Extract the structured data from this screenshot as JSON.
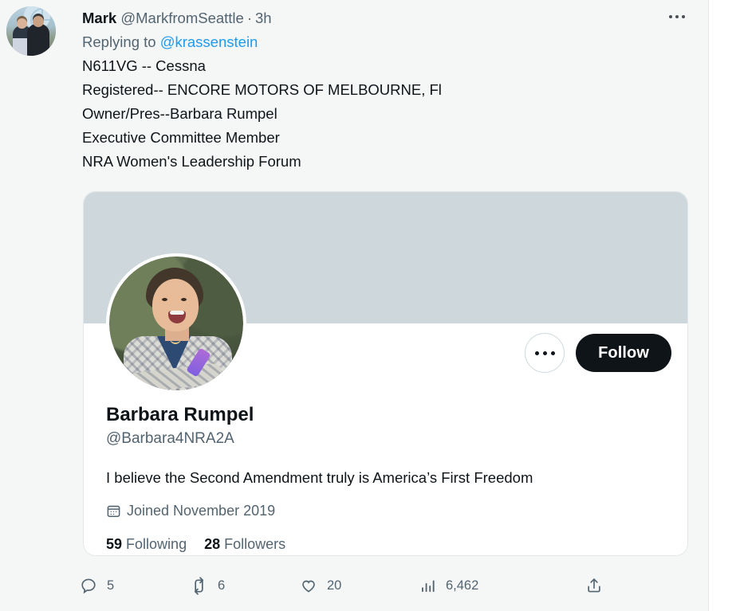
{
  "tweet": {
    "author_name": "Mark",
    "author_handle": "@MarkfromSeattle",
    "separator": "·",
    "timestamp": "3h",
    "replying_prefix": "Replying to",
    "replying_to_handle": "@krassenstein",
    "body": "N611VG -- Cessna\nRegistered-- ENCORE MOTORS OF MELBOURNE, Fl\nOwner/Pres--Barbara Rumpel\nExecutive Committee Member\nNRA Women's Leadership Forum",
    "more_icon": "more-horizontal-icon"
  },
  "profile_card": {
    "banner_color": "#ced8dc",
    "display_name": "Barbara Rumpel",
    "handle": "@Barbara4NRA2A",
    "bio": "I believe the Second Amendment truly is America’s First Freedom",
    "joined_icon": "calendar-icon",
    "joined": "Joined November 2019",
    "following_count": "59",
    "following_label": "Following",
    "followers_count": "28",
    "followers_label": "Followers",
    "more_button_icon": "more-horizontal-icon",
    "follow_button_label": "Follow",
    "follow_button_color": "#0f1419",
    "avatar_alt": "barbara-rumpel-avatar"
  },
  "actions": {
    "reply": {
      "icon": "reply-bubble-icon",
      "count": "5"
    },
    "retweet": {
      "icon": "retweet-icon",
      "count": "6"
    },
    "like": {
      "icon": "heart-icon",
      "count": "20"
    },
    "views": {
      "icon": "bar-chart-icon",
      "count": "6,462"
    },
    "share": {
      "icon": "share-upload-icon"
    }
  },
  "colors": {
    "page_background": "#f5f6f6",
    "card_background": "#ffffff",
    "link": "#1d9bf0",
    "muted_text": "#536471",
    "primary_text": "#0f1419"
  }
}
